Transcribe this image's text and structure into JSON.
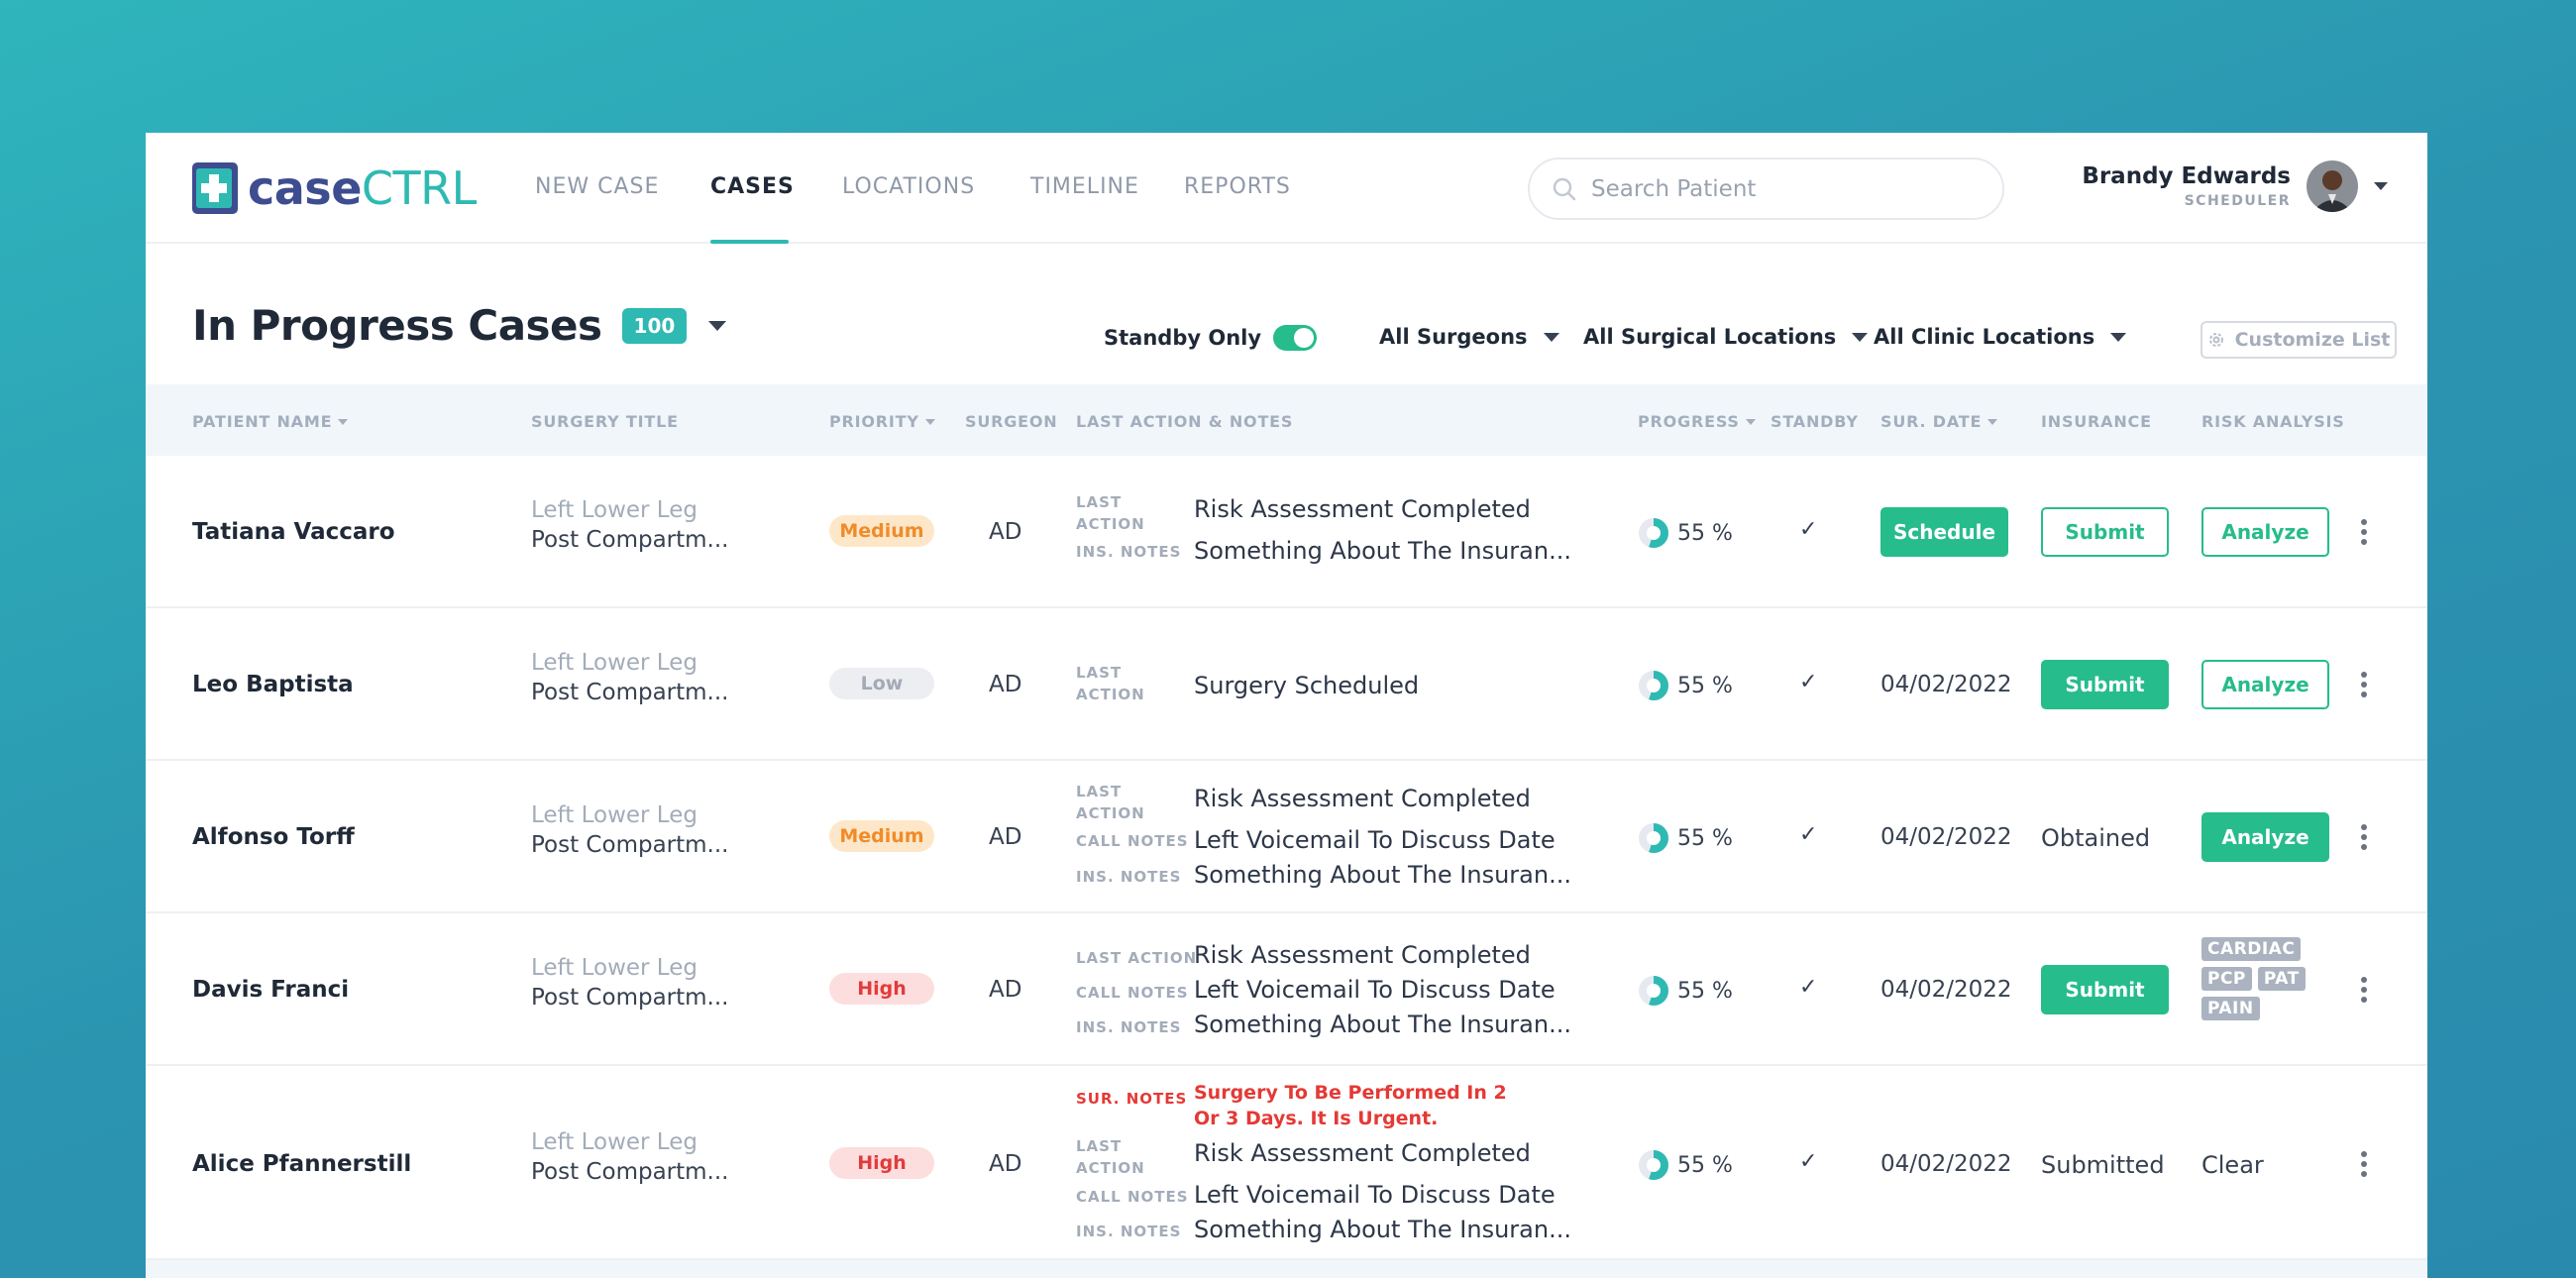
{
  "logo": {
    "part1": "case",
    "part2": "CTRL"
  },
  "nav": {
    "tabs": [
      {
        "label": "NEW CASE"
      },
      {
        "label": "CASES"
      },
      {
        "label": "LOCATIONS"
      },
      {
        "label": "TIMELINE"
      },
      {
        "label": "REPORTS"
      }
    ],
    "active_tab": "CASES"
  },
  "search": {
    "placeholder": "Search Patient",
    "value": ""
  },
  "user": {
    "name": "Brandy Edwards",
    "role": "SCHEDULER"
  },
  "page": {
    "title": "In Progress Cases",
    "count": "100"
  },
  "filters": {
    "standby_label": "Standby Only",
    "standby_on": true,
    "surgeons": "All Surgeons",
    "surgical_locations": "All Surgical Locations",
    "clinic_locations": "All Clinic Locations",
    "customize": "Customize List"
  },
  "columns": {
    "patient": "PATIENT NAME",
    "surgery": "SURGERY TITLE",
    "priority": "PRIORITY",
    "surgeon": "SURGEON",
    "notes": "LAST ACTION & NOTES",
    "progress": "PROGRESS",
    "standby": "STANDBY",
    "date": "SUR. DATE",
    "insurance": "INSURANCE",
    "risk": "RISK ANALYSIS"
  },
  "rows": [
    {
      "name": "Tatiana Vaccaro",
      "surgery_line1": "Left Lower Leg",
      "surgery_line2": "Post Compartm...",
      "priority": "Medium",
      "surgeon": "AD",
      "notes": [
        {
          "label": "LAST ACTION",
          "text": "Risk Assessment Completed"
        },
        {
          "label": "INS. NOTES",
          "text": "Something About The Insuran..."
        }
      ],
      "progress": "55 %",
      "standby": "✓",
      "date_button": "Schedule",
      "insurance_button": "Submit",
      "risk_button": "Analyze"
    },
    {
      "name": "Leo Baptista",
      "surgery_line1": "Left Lower Leg",
      "surgery_line2": "Post Compartm...",
      "priority": "Low",
      "surgeon": "AD",
      "notes": [
        {
          "label": "LAST ACTION",
          "text": "Surgery Scheduled"
        }
      ],
      "progress": "55 %",
      "standby": "✓",
      "date": "04/02/2022",
      "insurance_button": "Submit",
      "risk_button": "Analyze"
    },
    {
      "name": "Alfonso Torff",
      "surgery_line1": "Left Lower Leg",
      "surgery_line2": "Post Compartm...",
      "priority": "Medium",
      "surgeon": "AD",
      "notes": [
        {
          "label": "LAST ACTION",
          "text": "Risk Assessment Completed"
        },
        {
          "label": "CALL NOTES",
          "text": "Left Voicemail To Discuss Date"
        },
        {
          "label": "INS. NOTES",
          "text": "Something About The Insuran..."
        }
      ],
      "progress": "55 %",
      "standby": "✓",
      "date": "04/02/2022",
      "insurance": "Obtained",
      "risk_button": "Analyze"
    },
    {
      "name": "Davis Franci",
      "surgery_line1": "Left Lower Leg",
      "surgery_line2": "Post Compartm...",
      "priority": "High",
      "surgeon": "AD",
      "notes": [
        {
          "label": "LAST ACTION",
          "text": "Risk Assessment Completed"
        },
        {
          "label": "CALL NOTES",
          "text": "Left Voicemail To Discuss Date"
        },
        {
          "label": "INS. NOTES",
          "text": "Something About The Insuran..."
        }
      ],
      "progress": "55 %",
      "standby": "✓",
      "date": "04/02/2022",
      "insurance_button": "Submit",
      "risk_tags": [
        "CARDIAC",
        "PCP",
        "PAT",
        "PAIN"
      ]
    },
    {
      "name": "Alice Pfannerstill",
      "surgery_line1": "Left Lower Leg",
      "surgery_line2": "Post Compartm...",
      "priority": "High",
      "surgeon": "AD",
      "notes": [
        {
          "label": "SUR. NOTES",
          "text": "Surgery To Be Performed In 2 Or 3 Days. It Is Urgent."
        },
        {
          "label": "LAST ACTION",
          "text": "Risk Assessment Completed"
        },
        {
          "label": "CALL NOTES",
          "text": "Left Voicemail To Discuss Date"
        },
        {
          "label": "INS. NOTES",
          "text": "Something About The Insuran..."
        }
      ],
      "progress": "55 %",
      "standby": "✓",
      "date": "04/02/2022",
      "insurance": "Submitted",
      "risk": "Clear"
    }
  ],
  "colors": {
    "accent": "#2fb9b3",
    "green": "#26bc8b",
    "brand_dark": "#3d4d8f",
    "high": "#e23b3b",
    "medium": "#f08b2a"
  }
}
